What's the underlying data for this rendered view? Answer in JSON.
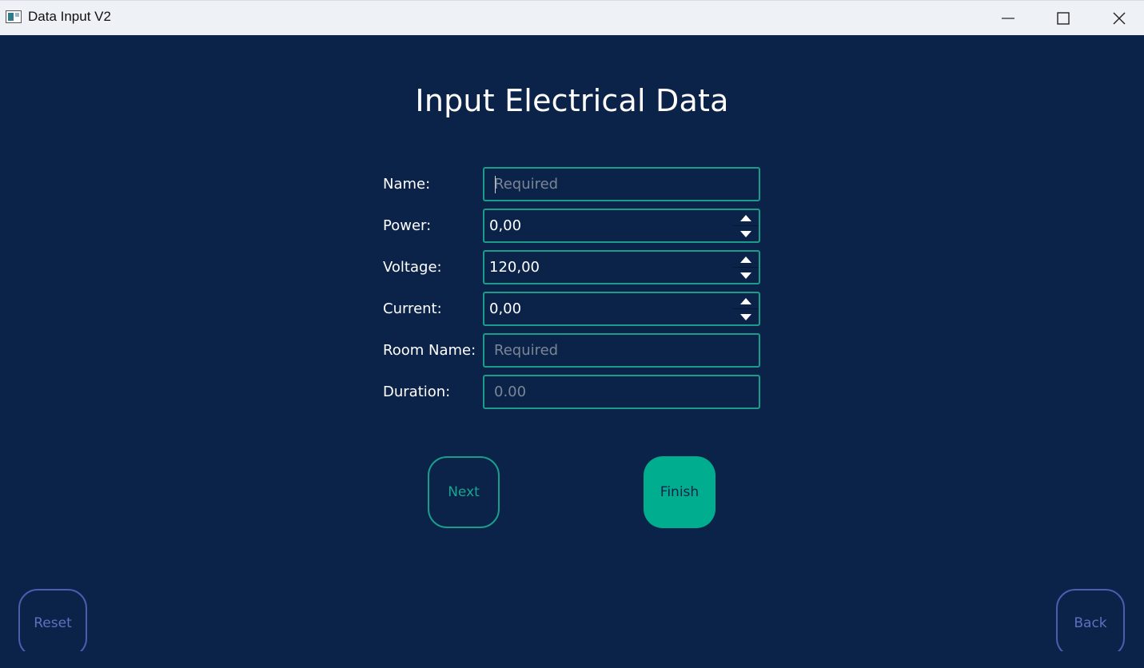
{
  "window": {
    "title": "Data Input V2"
  },
  "page": {
    "title": "Input Electrical Data"
  },
  "form": {
    "name": {
      "label": "Name:",
      "value": "",
      "placeholder": "Required"
    },
    "power": {
      "label": "Power:",
      "value": "0,00"
    },
    "voltage": {
      "label": "Voltage:",
      "value": "120,00"
    },
    "current": {
      "label": "Current:",
      "value": "0,00"
    },
    "room_name": {
      "label": "Room Name:",
      "value": "",
      "placeholder": "Required"
    },
    "duration": {
      "label": "Duration:",
      "value": "",
      "placeholder": "0.00"
    }
  },
  "buttons": {
    "next": "Next",
    "finish": "Finish",
    "reset": "Reset",
    "back": "Back"
  },
  "colors": {
    "background": "#0c2349",
    "accent": "#00ad8e",
    "secondary": "#4a5db0"
  }
}
